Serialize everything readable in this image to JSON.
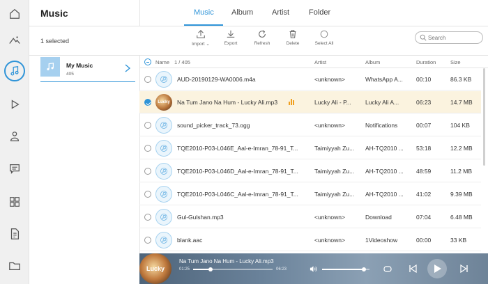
{
  "header": {
    "title": "Music",
    "tabs": [
      {
        "label": "Music",
        "active": true
      },
      {
        "label": "Album",
        "active": false
      },
      {
        "label": "Artist",
        "active": false
      },
      {
        "label": "Folder",
        "active": false
      }
    ]
  },
  "sidebar": {
    "icons": [
      "home-icon",
      "photos-icon",
      "music-icon",
      "video-icon",
      "contacts-icon",
      "messages-icon",
      "apps-icon",
      "documents-icon",
      "folder-icon"
    ],
    "active": "music-icon"
  },
  "toolbar": {
    "selected_text": "1 selected",
    "import_label": "Import",
    "export_label": "Export",
    "refresh_label": "Refresh",
    "delete_label": "Delete",
    "select_all_label": "Select All",
    "search_placeholder": "Search"
  },
  "library": {
    "name": "My Music",
    "count": "405"
  },
  "table": {
    "columns": {
      "name": "Name",
      "counter": "1 / 405",
      "artist": "Artist",
      "album": "Album",
      "duration": "Duration",
      "size": "Size"
    },
    "rows": [
      {
        "name": "AUD-20190129-WA0006.m4a",
        "artist": "<unknown>",
        "album": "WhatsApp A...",
        "duration": "00:10",
        "size": "86.3 KB",
        "selected": false,
        "has_art": false
      },
      {
        "name": "Na Tum Jano Na Hum - Lucky Ali.mp3",
        "artist": "Lucky Ali - P...",
        "album": "Lucky Ali A...",
        "duration": "06:23",
        "size": "14.7 MB",
        "selected": true,
        "has_art": true,
        "art_text": "Lucky"
      },
      {
        "name": "sound_picker_track_73.ogg",
        "artist": "<unknown>",
        "album": "Notifications",
        "duration": "00:07",
        "size": "104 KB",
        "selected": false,
        "has_art": false
      },
      {
        "name": "TQE2010-P03-L046E_Aal-e-Imran_78-91_T...",
        "artist": "Taimiyyah Zu...",
        "album": "AH-TQ2010 ...",
        "duration": "53:18",
        "size": "12.2 MB",
        "selected": false,
        "has_art": false
      },
      {
        "name": "TQE2010-P03-L046D_Aal-e-Imran_78-91_T...",
        "artist": "Taimiyyah Zu...",
        "album": "AH-TQ2010 ...",
        "duration": "48:59",
        "size": "11.2 MB",
        "selected": false,
        "has_art": false
      },
      {
        "name": "TQE2010-P03-L046C_Aal-e-Imran_78-91_T...",
        "artist": "Taimiyyah Zu...",
        "album": "AH-TQ2010 ...",
        "duration": "41:02",
        "size": "9.39 MB",
        "selected": false,
        "has_art": false
      },
      {
        "name": "Gul-Gulshan.mp3",
        "artist": "<unknown>",
        "album": "Download",
        "duration": "07:04",
        "size": "6.48 MB",
        "selected": false,
        "has_art": false
      },
      {
        "name": "blank.aac",
        "artist": "<unknown>",
        "album": "1Videoshow",
        "duration": "00:00",
        "size": "33 KB",
        "selected": false,
        "has_art": false
      }
    ]
  },
  "player": {
    "title": "Na Tum Jano Na Hum - Lucky Ali.mp3",
    "art_text": "Lucky",
    "elapsed": "01:25",
    "total": "06:23",
    "progress": 0.22,
    "volume": 0.88
  },
  "colors": {
    "accent": "#2f94d8",
    "selected_row": "#fbf3df",
    "equalizer": "#f0a020"
  }
}
